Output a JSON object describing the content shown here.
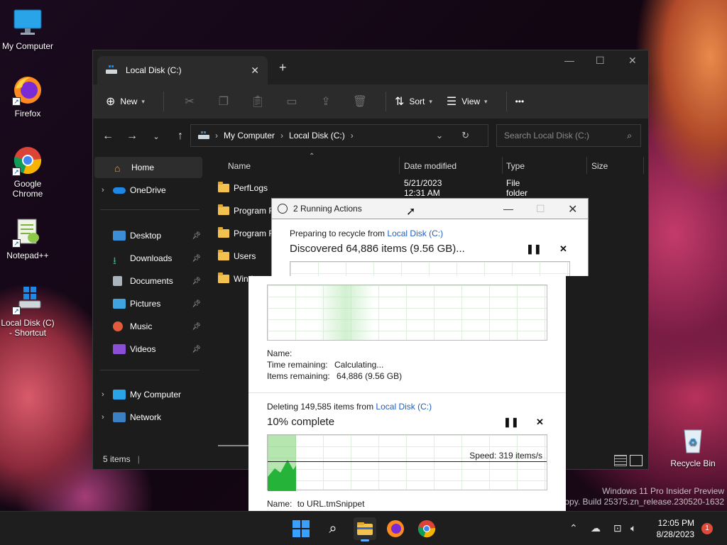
{
  "desktop": {
    "icons": [
      {
        "label": "My Computer"
      },
      {
        "label": "Firefox"
      },
      {
        "label": "Google Chrome"
      },
      {
        "label": "Notepad++"
      },
      {
        "label": "Local Disk (C) - Shortcut"
      },
      {
        "label": "Recycle Bin"
      }
    ],
    "watermark_line1": "Windows 11 Pro Insider Preview",
    "watermark_line2": "n copy. Build 25375.zn_release.230520-1632"
  },
  "explorer": {
    "tab_title": "Local Disk (C:)",
    "toolbar": {
      "new": "New",
      "sort": "Sort",
      "view": "View",
      "more": "•••"
    },
    "breadcrumb": [
      "My Computer",
      "Local Disk (C:)"
    ],
    "search_placeholder": "Search Local Disk (C:)",
    "sidebar": {
      "home": "Home",
      "onedrive": "OneDrive",
      "desktop": "Desktop",
      "downloads": "Downloads",
      "documents": "Documents",
      "pictures": "Pictures",
      "music": "Music",
      "videos": "Videos",
      "mycomputer": "My Computer",
      "network": "Network"
    },
    "columns": {
      "name": "Name",
      "date": "Date modified",
      "type": "Type",
      "size": "Size"
    },
    "rows": [
      {
        "name": "PerfLogs",
        "date": "5/21/2023 12:31 AM",
        "type": "File folder"
      },
      {
        "name": "Program F"
      },
      {
        "name": "Program F"
      },
      {
        "name": "Users"
      },
      {
        "name": "Windows"
      }
    ],
    "status": "5 items"
  },
  "dialog": {
    "title": "2 Running Actions",
    "action1": {
      "prefix": "Preparing to recycle from",
      "source": "Local Disk (C:)",
      "headline": "Discovered 64,886 items (9.56 GB)...",
      "name_label": "Name:",
      "time_label": "Time remaining:",
      "time_value": "Calculating...",
      "items_label": "Items remaining:",
      "items_value": "64,886 (9.56 GB)"
    },
    "action2": {
      "prefix": "Deleting 149,585 items from",
      "source": "Local Disk (C:)",
      "headline": "10% complete",
      "progress": 0.1,
      "speed": "Speed: 319 items/s",
      "name_label": "Name:",
      "name_value": "to URL.tmSnippet"
    }
  },
  "taskbar": {
    "time": "12:05 PM",
    "date": "8/28/2023",
    "notifications": "1"
  }
}
